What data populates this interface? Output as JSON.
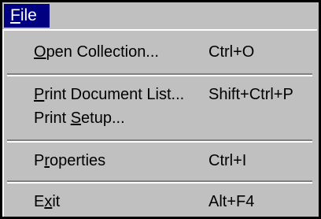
{
  "menubar": {
    "title_accel": "F",
    "title_rest": "ile"
  },
  "menu": {
    "open_collection": {
      "accel": "O",
      "rest": "pen Collection...",
      "shortcut": "Ctrl+O"
    },
    "print_document_list": {
      "accel": "P",
      "rest": "rint Document List...",
      "shortcut": "Shift+Ctrl+P"
    },
    "print_setup": {
      "before": "Print ",
      "accel": "S",
      "rest": "etup...",
      "shortcut": ""
    },
    "properties": {
      "before": "P",
      "accel": "r",
      "rest": "operties",
      "shortcut": "Ctrl+I"
    },
    "exit": {
      "before": "E",
      "accel": "x",
      "rest": "it",
      "shortcut": "Alt+F4"
    }
  },
  "colors": {
    "menu_bg": "#c0c0c0",
    "title_bg": "#000080",
    "title_fg": "#ffffff",
    "border": "#000000"
  }
}
